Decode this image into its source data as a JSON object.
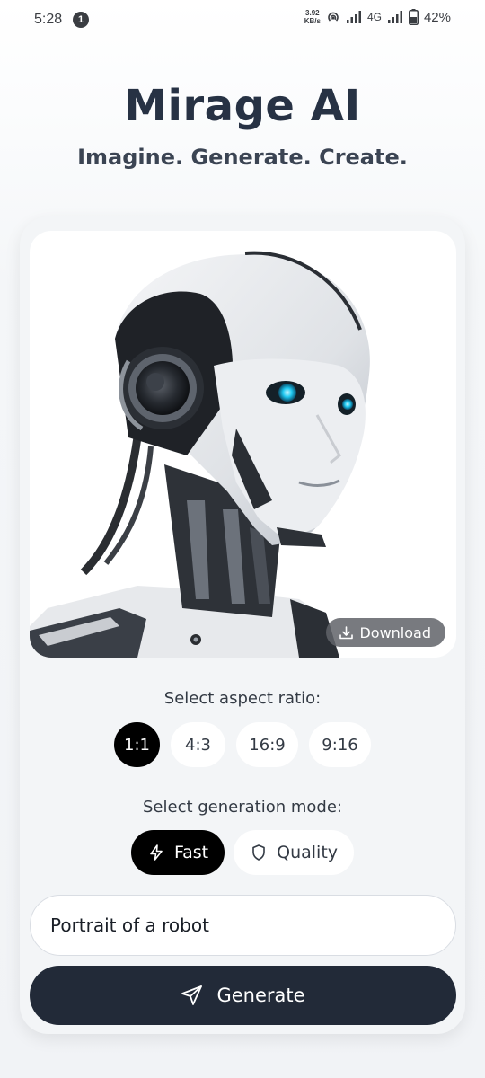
{
  "status_bar": {
    "time": "5:28",
    "notification_count": "1",
    "net_speed_value": "3.92",
    "net_speed_unit": "KB/s",
    "network": "4G",
    "battery": "42%"
  },
  "header": {
    "title": "Mirage AI",
    "subtitle": "Imagine. Generate. Create."
  },
  "image_panel": {
    "download_label": "Download"
  },
  "aspect_ratio": {
    "label": "Select aspect ratio:",
    "options": [
      "1:1",
      "4:3",
      "16:9",
      "9:16"
    ],
    "selected": "1:1"
  },
  "generation_mode": {
    "label": "Select generation mode:",
    "options": [
      "Fast",
      "Quality"
    ],
    "selected": "Fast"
  },
  "prompt": {
    "value": "Portrait of a robot"
  },
  "generate_button": {
    "label": "Generate"
  },
  "colors": {
    "accent_dark": "#222a38",
    "selected_pill": "#000000",
    "title": "#273244",
    "robot_eye": "#1ec8f0"
  }
}
